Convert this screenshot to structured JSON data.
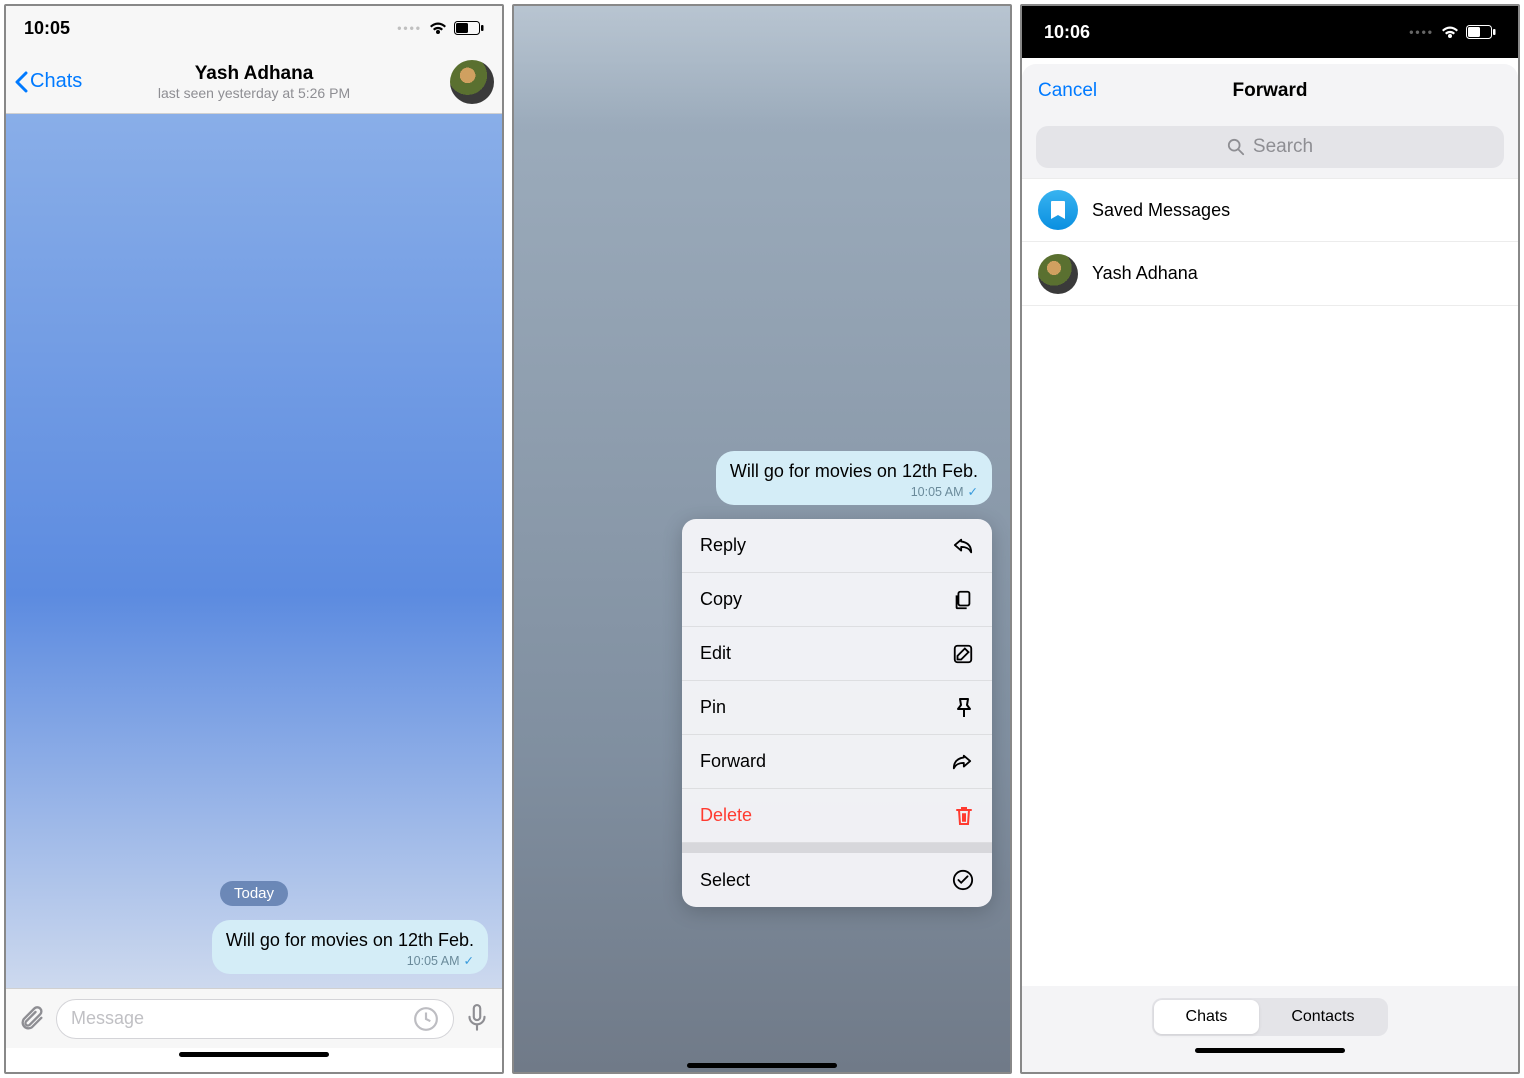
{
  "screen1": {
    "statusbar": {
      "time": "10:05"
    },
    "header": {
      "back_label": "Chats",
      "contact_name": "Yash Adhana",
      "status_text": "last seen yesterday at 5:26 PM"
    },
    "date_label": "Today",
    "message": {
      "text": "Will go for movies on 12th Feb.",
      "time": "10:05 AM"
    },
    "input": {
      "placeholder": "Message"
    }
  },
  "screen2": {
    "message": {
      "text": "Will go for movies on 12th Feb.",
      "time": "10:05 AM"
    },
    "menu": {
      "reply": "Reply",
      "copy": "Copy",
      "edit": "Edit",
      "pin": "Pin",
      "forward": "Forward",
      "delete": "Delete",
      "select": "Select"
    }
  },
  "screen3": {
    "statusbar": {
      "time": "10:06"
    },
    "header": {
      "cancel": "Cancel",
      "title": "Forward"
    },
    "search": {
      "placeholder": "Search"
    },
    "rows": {
      "saved": "Saved Messages",
      "contact1": "Yash Adhana"
    },
    "segment": {
      "chats": "Chats",
      "contacts": "Contacts"
    }
  }
}
